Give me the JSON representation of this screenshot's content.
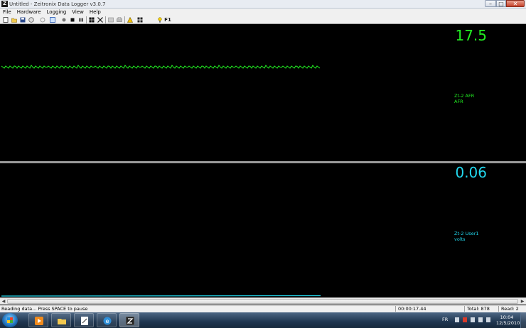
{
  "window": {
    "title": "Untitled - Zeitronix Data Logger v3.0.7",
    "app_icon": "Z",
    "minimize_glyph": "–",
    "maximize_glyph": "□",
    "close_glyph": "✕"
  },
  "menu": [
    "File",
    "Hardware",
    "Logging",
    "View",
    "Help"
  ],
  "toolbar": {
    "icons": [
      "new-file-icon",
      "open-folder-icon",
      "save-icon",
      "record-settings-icon",
      "loop-icon",
      "window-icon",
      "record-icon",
      "stop-icon",
      "pause-icon",
      "grid-icon",
      "expand-icon",
      "print-preview-icon",
      "print-icon",
      "warning-icon",
      "layout-icon",
      "help-icon"
    ],
    "f1_label": "F1"
  },
  "panels": [
    {
      "value": "17.5",
      "name": "Zt-2 AFR",
      "unit": "AFR",
      "color": "#22ee22"
    },
    {
      "value": "0.06",
      "name": "Zt-2 User1",
      "unit": "volts",
      "color": "#22d8ee"
    }
  ],
  "status": {
    "message": "Reading data... Press SPACE to pause",
    "elapsed": "00:00:17.44",
    "total": "Total: 878",
    "read": "Read: 2"
  },
  "taskbar": {
    "language": "FR",
    "time": "10:04",
    "date": "12/5/2010",
    "colors": {
      "bar": "#1f3650"
    }
  },
  "scrollbar": {
    "left_arrow": "◀",
    "right_arrow": "▶"
  }
}
